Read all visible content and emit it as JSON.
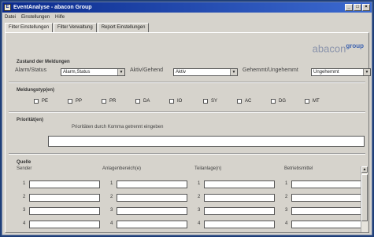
{
  "window": {
    "title": "EventAnalyse - abacon Group",
    "buttons": [
      "_",
      "□",
      "×"
    ]
  },
  "menu": [
    "Datei",
    "Einstellungen",
    "Hilfe"
  ],
  "tabs": [
    {
      "label": "Filter Einstellungen",
      "active": true
    },
    {
      "label": "Filter Verwaltung",
      "active": false
    },
    {
      "label": "Report Einstellungen",
      "active": false
    }
  ],
  "logo": {
    "brand": "abacon",
    "suffix": "group"
  },
  "zustand": {
    "title": "Zustand der Meldungen",
    "alarm": {
      "label": "Alarm/Status",
      "value": "Alarm,Status"
    },
    "aktiv": {
      "label": "Aktiv/Gehend",
      "value": "Aktiv"
    },
    "quitt": {
      "label": "Gehemmt/Ungehemmt",
      "value": "Ungehemmt"
    }
  },
  "meldungstyp": {
    "title": "Meldungstyp(en)",
    "options": [
      "PE",
      "PP",
      "PR",
      "DA",
      "IO",
      "SY",
      "AC",
      "DG",
      "MT"
    ]
  },
  "prioritaet": {
    "title": "Priorität(en)",
    "hint": "Prioritäten durch Komma getrennt eingeben",
    "value": ""
  },
  "quelle": {
    "title": "Quelle",
    "columns": [
      "Sender",
      "Anlagenbereich(e)",
      "Teilanlage(n)",
      "Betriebsmittel"
    ],
    "rows": [
      "1",
      "2",
      "3",
      "4"
    ]
  }
}
